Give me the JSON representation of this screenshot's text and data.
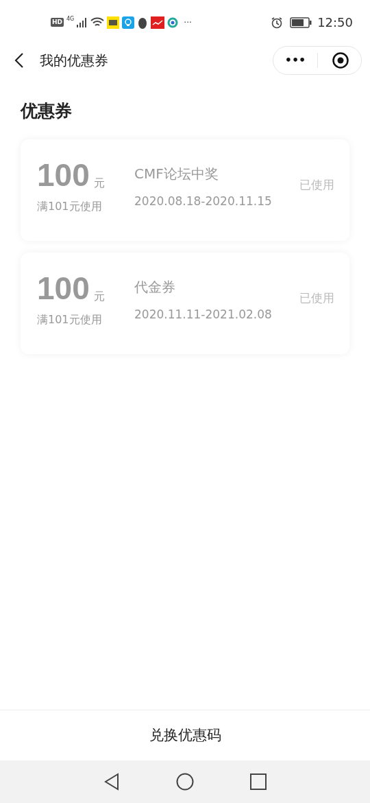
{
  "status_bar": {
    "hd": "HD",
    "network": "4G",
    "more": "···",
    "time": "12:50"
  },
  "nav": {
    "title": "我的优惠券",
    "menu": "•••"
  },
  "heading": "优惠券",
  "coupons": [
    {
      "amount": "100",
      "unit": "元",
      "condition": "满101元使用",
      "name": "CMF论坛中奖",
      "period": "2020.08.18-2020.11.15",
      "status": "已使用",
      "used": true
    },
    {
      "amount": "100",
      "unit": "元",
      "condition": "满101元使用",
      "name": "代金券",
      "period": "2020.11.11-2021.02.08",
      "status": "已使用",
      "used": true
    }
  ],
  "redeem_button": "兑换优惠码"
}
